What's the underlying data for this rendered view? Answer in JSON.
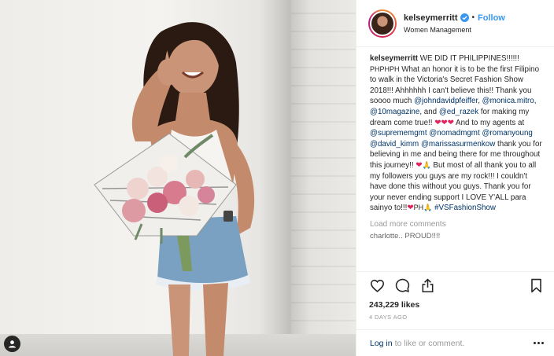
{
  "post": {
    "author": "kelseymerritt",
    "follow_label": "Follow",
    "location": "Women Management",
    "separator": "•"
  },
  "caption": {
    "author": "kelseymerritt",
    "p1": " WE DID IT PHILIPPINES!!!!!! ",
    "flag_small": "PHPHPH",
    "p2": " What an honor it is to be the first Filipino to walk in the Victoria's Secret Fashion Show 2018!!! Ahhhhhh I can't believe this!! Thank you soooo much ",
    "m1": "@johndavidpfeiffer",
    "c1": ", ",
    "m2": "@monica.mitro",
    "c2": ", ",
    "m3": "@10magazine",
    "c3": ", and ",
    "m4": "@ed_razek",
    "p3": " for making my dream come true!! ",
    "hearts1": "❤❤❤",
    "p4": " And to my agents at ",
    "m5": "@suprememgmt",
    "c4": " ",
    "m6": "@nomadmgmt",
    "c5": " ",
    "m7": "@romanyoung",
    "c6": " ",
    "m8": "@david_kimm",
    "c7": " ",
    "m9": "@marissasurmenkow",
    "p5": " thank you for believing in me and being there for me throughout this journey!! ",
    "heart2": "❤",
    "emoji_pray": "🙏",
    "p6": " But most of all thank you to all my followers you guys are my rock!!! I couldn't have done this without you guys. Thank you for your never ending support I LOVE Y'ALL para sainyo to!!!",
    "heart3": "❤",
    "flag_small2": "PH",
    "emoji_pray2": "🙏",
    "c8": " ",
    "hashtag": "#VSFashionShow"
  },
  "comments": {
    "load_more": "Load more comments",
    "next_partial": "charlotte.. PROUD!!!!"
  },
  "actions": {
    "likes": "243,229 likes",
    "time_ago": "4 DAYS AGO"
  },
  "comment_bar": {
    "login": "Log in",
    "rest": "to like or comment."
  },
  "colors": {
    "link": "#003569",
    "follow": "#3897f0",
    "heart": "#e0245e",
    "muted": "#999999"
  }
}
